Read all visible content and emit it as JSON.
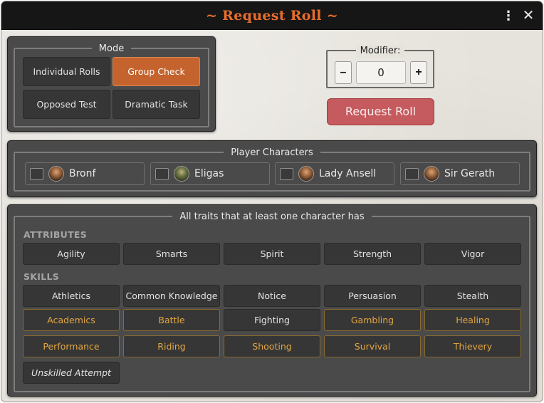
{
  "window": {
    "title": "~ Request Roll ~",
    "menu_icon": "more-vertical-icon",
    "close_icon": "close-icon"
  },
  "mode": {
    "legend": "Mode",
    "buttons": [
      {
        "label": "Individual Rolls",
        "active": false
      },
      {
        "label": "Group Check",
        "active": true
      },
      {
        "label": "Opposed Test",
        "active": false
      },
      {
        "label": "Dramatic Task",
        "active": false
      }
    ]
  },
  "modifier": {
    "legend": "Modifier:",
    "value": "0",
    "minus_label": "–",
    "plus_label": "+"
  },
  "request_button": "Request Roll",
  "players": {
    "legend": "Player Characters",
    "list": [
      {
        "name": "Bronf"
      },
      {
        "name": "Eligas"
      },
      {
        "name": "Lady Ansell"
      },
      {
        "name": "Sir Gerath"
      }
    ]
  },
  "traits": {
    "legend": "All traits that at least one character has",
    "attributes_label": "ATTRIBUTES",
    "attributes": [
      "Agility",
      "Smarts",
      "Spirit",
      "Strength",
      "Vigor"
    ],
    "skills_label": "SKILLS",
    "core_skills": [
      "Athletics",
      "Common Knowledge",
      "Notice",
      "Persuasion",
      "Stealth"
    ],
    "skills_row2": [
      {
        "label": "Academics",
        "highlight": true
      },
      {
        "label": "Battle",
        "highlight": true
      },
      {
        "label": "Fighting",
        "highlight": false
      },
      {
        "label": "Gambling",
        "highlight": true
      },
      {
        "label": "Healing",
        "highlight": true
      }
    ],
    "skills_row3": [
      "Performance",
      "Riding",
      "Shooting",
      "Survival",
      "Thievery"
    ],
    "unskilled": "Unskilled Attempt"
  },
  "colors": {
    "accent": "#ea6d2c",
    "active_button": "#c4632d",
    "highlight_text": "#e3a640",
    "request_button": "#c55b5e"
  }
}
